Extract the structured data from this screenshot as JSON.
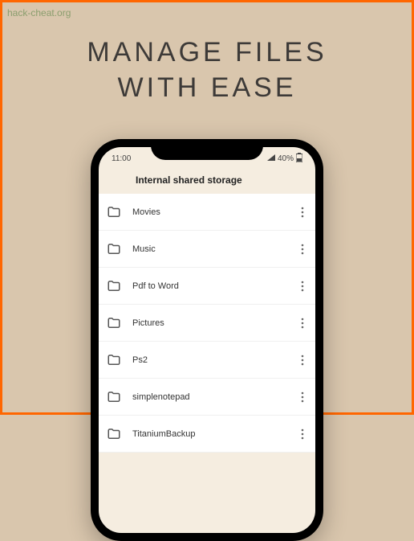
{
  "watermark": "hack-cheat.org",
  "headline_line1": "MANAGE FILES",
  "headline_line2": "WITH EASE",
  "status": {
    "time": "11:00",
    "battery": "40%"
  },
  "app": {
    "title": "Internal shared storage"
  },
  "files": [
    {
      "name": "Movies"
    },
    {
      "name": "Music"
    },
    {
      "name": "Pdf to Word"
    },
    {
      "name": "Pictures"
    },
    {
      "name": "Ps2"
    },
    {
      "name": "simplenotepad"
    },
    {
      "name": "TitaniumBackup"
    }
  ]
}
